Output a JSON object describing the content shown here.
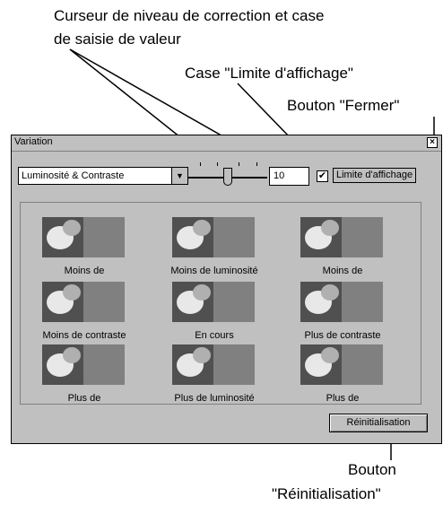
{
  "callouts": {
    "slider_line1": "Curseur de niveau de correction et case",
    "slider_line2": "de saisie de valeur",
    "limit_box": "Case \"Limite d'affichage\"",
    "close": "Bouton \"Fermer\"",
    "reset_line1": "Bouton",
    "reset_line2": "\"Réinitialisation\""
  },
  "window": {
    "title": "Variation",
    "close_glyph": "×",
    "mode_select": "Luminosité & Contraste",
    "dropdown_arrow": "▼",
    "value": "10",
    "limit_checked": "✔",
    "limit_label": "Limite d'affichage",
    "cells": [
      {
        "label": "Moins de"
      },
      {
        "label": "Moins de luminosité"
      },
      {
        "label": "Moins de"
      },
      {
        "label": "Moins de contraste"
      },
      {
        "label": "En cours"
      },
      {
        "label": "Plus de contraste"
      },
      {
        "label": "Plus de"
      },
      {
        "label": "Plus de luminosité"
      },
      {
        "label": "Plus de"
      }
    ],
    "reset_label": "Réinitialisation"
  }
}
